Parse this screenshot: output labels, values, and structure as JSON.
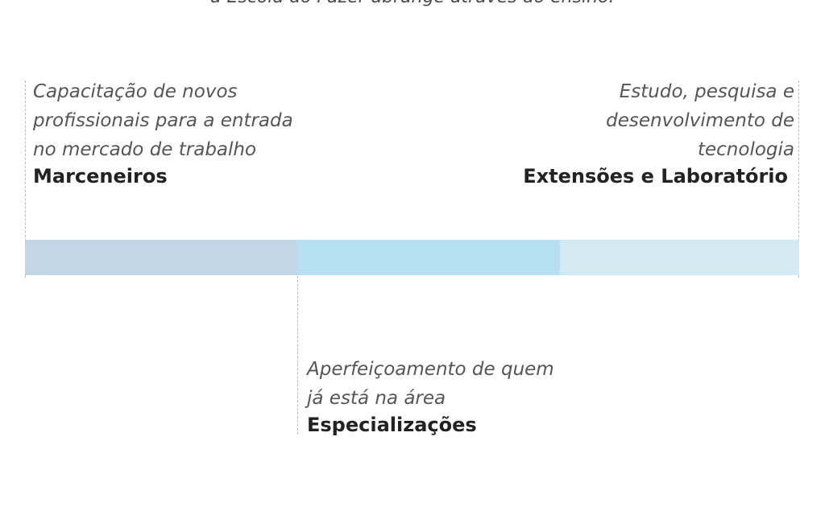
{
  "caption": "a Escola do Fazer abrange através do ensino:",
  "segments": [
    {
      "desc_lines": [
        "Capacitação de novos",
        "profissionais para a entrada",
        "no mercado de trabalho"
      ],
      "title": "Marceneiros",
      "color": "#c3d6e6"
    },
    {
      "desc_lines": [
        "Aperfeiçoamento de quem",
        "já está na área"
      ],
      "title": "Especializações",
      "color": "#b7e1f2"
    },
    {
      "desc_lines": [
        "Estudo, pesquisa e",
        "desenvolvimento de",
        "tecnologia"
      ],
      "title": "Extensões e Laboratório",
      "color": "#d4eaf3"
    }
  ]
}
